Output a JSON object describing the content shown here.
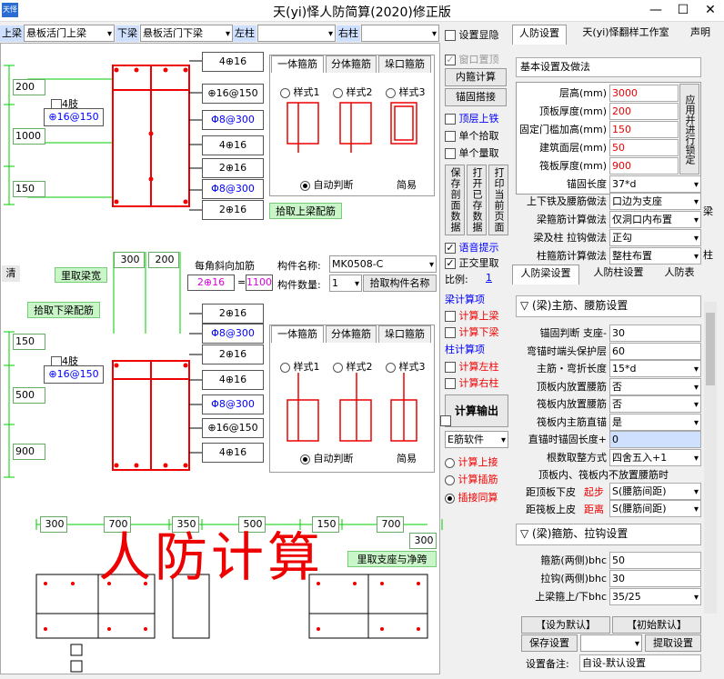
{
  "window": {
    "title": "天(yi)怿人防简算(2020)修正版",
    "icon": "天怿",
    "min": "—",
    "max": "☐",
    "close": "✕"
  },
  "beams": {
    "top_label": "上梁",
    "top_value": "悬板活门上梁",
    "bottom_label": "下梁",
    "bottom_value": "悬板活门下梁",
    "left_label": "左柱",
    "left_value": "",
    "right_label": "右柱",
    "right_value": ""
  },
  "top_tabs": [
    "设置显隐",
    "人防设置",
    "天(yi)怿翻样工作室",
    "声明"
  ],
  "mid_panel": {
    "window_top": "窗口置顶",
    "calc_btn": "内箍计算",
    "anchor_btn": "锚固搭接",
    "top_iron": "顶层上铁",
    "single_pick": "单个拾取",
    "single_measure": "单个量取",
    "save_btn": "保存剖面数据",
    "open_btn": "打开已存数据",
    "print_btn": "打印当前页面",
    "voice": "语音提示",
    "orth": "正交里取",
    "scale_label": "比例:",
    "scale_value": "1",
    "beam_calc": "梁计算项",
    "calc_top": "计算上梁",
    "calc_bottom": "计算下梁",
    "col_calc": "柱计算项",
    "calc_left": "计算左柱",
    "calc_right": "计算右柱",
    "output": "计算输出",
    "software": "E筋软件",
    "r_top": "计算上接",
    "r_insert": "计算插筋",
    "r_lap": "插接同算"
  },
  "upper": {
    "legs": "4肢",
    "stirrup": "⊕16@150",
    "dims": [
      "200",
      "1000",
      "150"
    ],
    "bars": [
      "4⊕16",
      "⊕16@150",
      "Φ8@300",
      "4⊕16",
      "2⊕16",
      "Φ8@300",
      "2⊕16"
    ],
    "pick_btn": "拾取上梁配筋",
    "tabs": [
      "一体箍筋",
      "分体箍筋",
      "垛口箍筋"
    ],
    "styles": [
      "样式1",
      "样式2",
      "样式3"
    ],
    "auto": "自动判断",
    "simple": "简易"
  },
  "middle": {
    "clear": "清",
    "measure_width": "里取梁宽",
    "dims": [
      "300",
      "200"
    ],
    "diag_label": "每角斜向加筋",
    "diag_bar": "2⊕16",
    "eq": "=",
    "diag_len": "1100",
    "member_label": "构件名称:",
    "member_value": "MK0508-C",
    "count_label": "构件数量:",
    "count_value": "1",
    "pick_member": "拾取构件名称",
    "pick_lower": "拾取下梁配筋"
  },
  "lower": {
    "legs": "4肢",
    "stirrup": "⊕16@150",
    "dims": [
      "150",
      "500",
      "900"
    ],
    "bars": [
      "2⊕16",
      "Φ8@300",
      "2⊕16",
      "4⊕16",
      "Φ8@300",
      "⊕16@150",
      "4⊕16"
    ],
    "tabs": [
      "一体箍筋",
      "分体箍筋",
      "垛口箍筋"
    ],
    "styles": [
      "样式1",
      "样式2",
      "样式3"
    ],
    "auto": "自动判断",
    "simple": "简易"
  },
  "bottom_plan": {
    "dims": [
      "300",
      "700",
      "350",
      "500",
      "150",
      "700",
      "300"
    ],
    "banner": "人防计算",
    "measure_btn": "里取支座与净跨"
  },
  "right": {
    "basic_title": "基本设置及做法",
    "apply_btn": "应用并进行锁定",
    "basic_rows": [
      {
        "label": "层高(mm)",
        "value": "3000",
        "red": true
      },
      {
        "label": "顶板厚度(mm)",
        "value": "200",
        "red": true
      },
      {
        "label": "固定门槛加高(mm)",
        "value": "150",
        "red": true
      },
      {
        "label": "建筑面层(mm)",
        "value": "50",
        "red": true
      },
      {
        "label": "筏板厚度(mm)",
        "value": "900",
        "red": true
      },
      {
        "label": "锚固长度",
        "value": "37*d",
        "red": false
      }
    ],
    "method_rows": [
      {
        "label": "上下铁及腰筋做法",
        "value": "口边为支座"
      },
      {
        "label": "梁箍筋计算做法",
        "value": "仅洞口内布置"
      },
      {
        "label": "梁及柱 拉钩做法",
        "value": "正勾"
      },
      {
        "label": "柱箍筋计算做法",
        "value": "整柱布置"
      }
    ],
    "side_beam": "梁",
    "side_col": "柱",
    "tabs2": [
      "人防梁设置",
      "人防柱设置",
      "人防表"
    ],
    "main_title": "▽ (梁)主筋、腰筋设置",
    "main_rows": [
      {
        "label": "锚固判断 支座-",
        "value": "30"
      },
      {
        "label": "弯锚时端头保护层",
        "value": "60"
      },
      {
        "label": "主筋・弯折长度",
        "value": "15*d"
      },
      {
        "label": "顶板内放置腰筋",
        "value": "否"
      },
      {
        "label": "筏板内放置腰筋",
        "value": "否"
      },
      {
        "label": "筏板内主筋直锚",
        "value": "是"
      },
      {
        "label": "直锚时锚固长度+",
        "value": "0"
      },
      {
        "label": "根数取整方式",
        "value": "四舍五入+1"
      }
    ],
    "note": "顶板内、筏板内不放置腰筋时",
    "dist_top_label": "距顶板下皮",
    "dist_top_tag": "起步",
    "dist_top_value": "S(腰筋间距)",
    "dist_bot_label": "距筏板上皮",
    "dist_bot_tag": "距离",
    "dist_bot_value": "S(腰筋间距)",
    "stirrup_title": "▽ (梁)箍筋、拉钩设置",
    "stirrup_rows": [
      {
        "label": "箍筋(两侧)bhc",
        "value": "50"
      },
      {
        "label": "拉钩(两侧)bhc",
        "value": "30"
      },
      {
        "label": "上梁箍上/下bhc",
        "value": "35/25"
      }
    ],
    "set_default": "【设为默认】",
    "init_default": "【初始默认】",
    "save_setting": "保存设置",
    "load_setting": "提取设置",
    "remark_label": "设置备注:",
    "remark_value": "自设-默认设置"
  }
}
